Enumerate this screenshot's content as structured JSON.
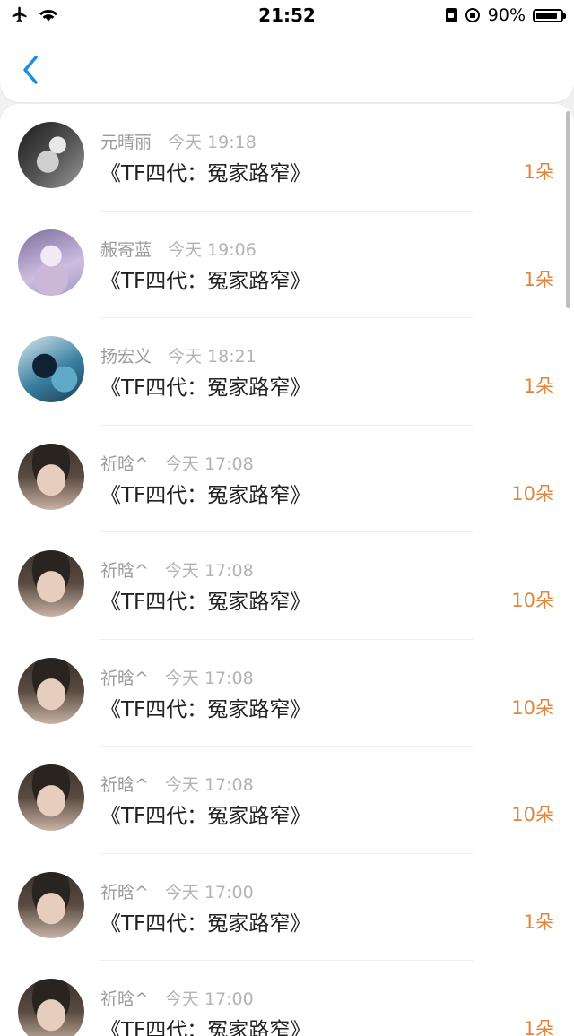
{
  "status_bar": {
    "time": "21:52",
    "battery": "90%",
    "battery_level": 0.9,
    "icons": [
      "airplane-icon",
      "wifi-icon",
      "portrait-lock-icon",
      "orientation-lock-icon",
      "battery-icon"
    ]
  },
  "nav": {
    "back_icon": "chevron-left-icon",
    "accent_color": "#1a8fe3"
  },
  "colors": {
    "count": "#e2853c",
    "name": "#9b9b9b",
    "title": "#222222"
  },
  "items": [
    {
      "name": "元晴丽",
      "time": "今天 19:18",
      "title": "《TF四代：冤家路窄》",
      "count": "1朵",
      "avatar": "avatar-1"
    },
    {
      "name": "赧寄蓝",
      "time": "今天 19:06",
      "title": "《TF四代：冤家路窄》",
      "count": "1朵",
      "avatar": "avatar-2"
    },
    {
      "name": "扬宏义",
      "time": "今天 18:21",
      "title": "《TF四代：冤家路窄》",
      "count": "1朵",
      "avatar": "avatar-3"
    },
    {
      "name": "祈晗^",
      "time": "今天 17:08",
      "title": "《TF四代：冤家路窄》",
      "count": "10朵",
      "avatar": "avatar-4"
    },
    {
      "name": "祈晗^",
      "time": "今天 17:08",
      "title": "《TF四代：冤家路窄》",
      "count": "10朵",
      "avatar": "avatar-4"
    },
    {
      "name": "祈晗^",
      "time": "今天 17:08",
      "title": "《TF四代：冤家路窄》",
      "count": "10朵",
      "avatar": "avatar-4"
    },
    {
      "name": "祈晗^",
      "time": "今天 17:08",
      "title": "《TF四代：冤家路窄》",
      "count": "10朵",
      "avatar": "avatar-4"
    },
    {
      "name": "祈晗^",
      "time": "今天 17:00",
      "title": "《TF四代：冤家路窄》",
      "count": "1朵",
      "avatar": "avatar-4"
    },
    {
      "name": "祈晗^",
      "time": "今天 17:00",
      "title": "《TF四代：冤家路窄》",
      "count": "1朵",
      "avatar": "avatar-4"
    }
  ]
}
